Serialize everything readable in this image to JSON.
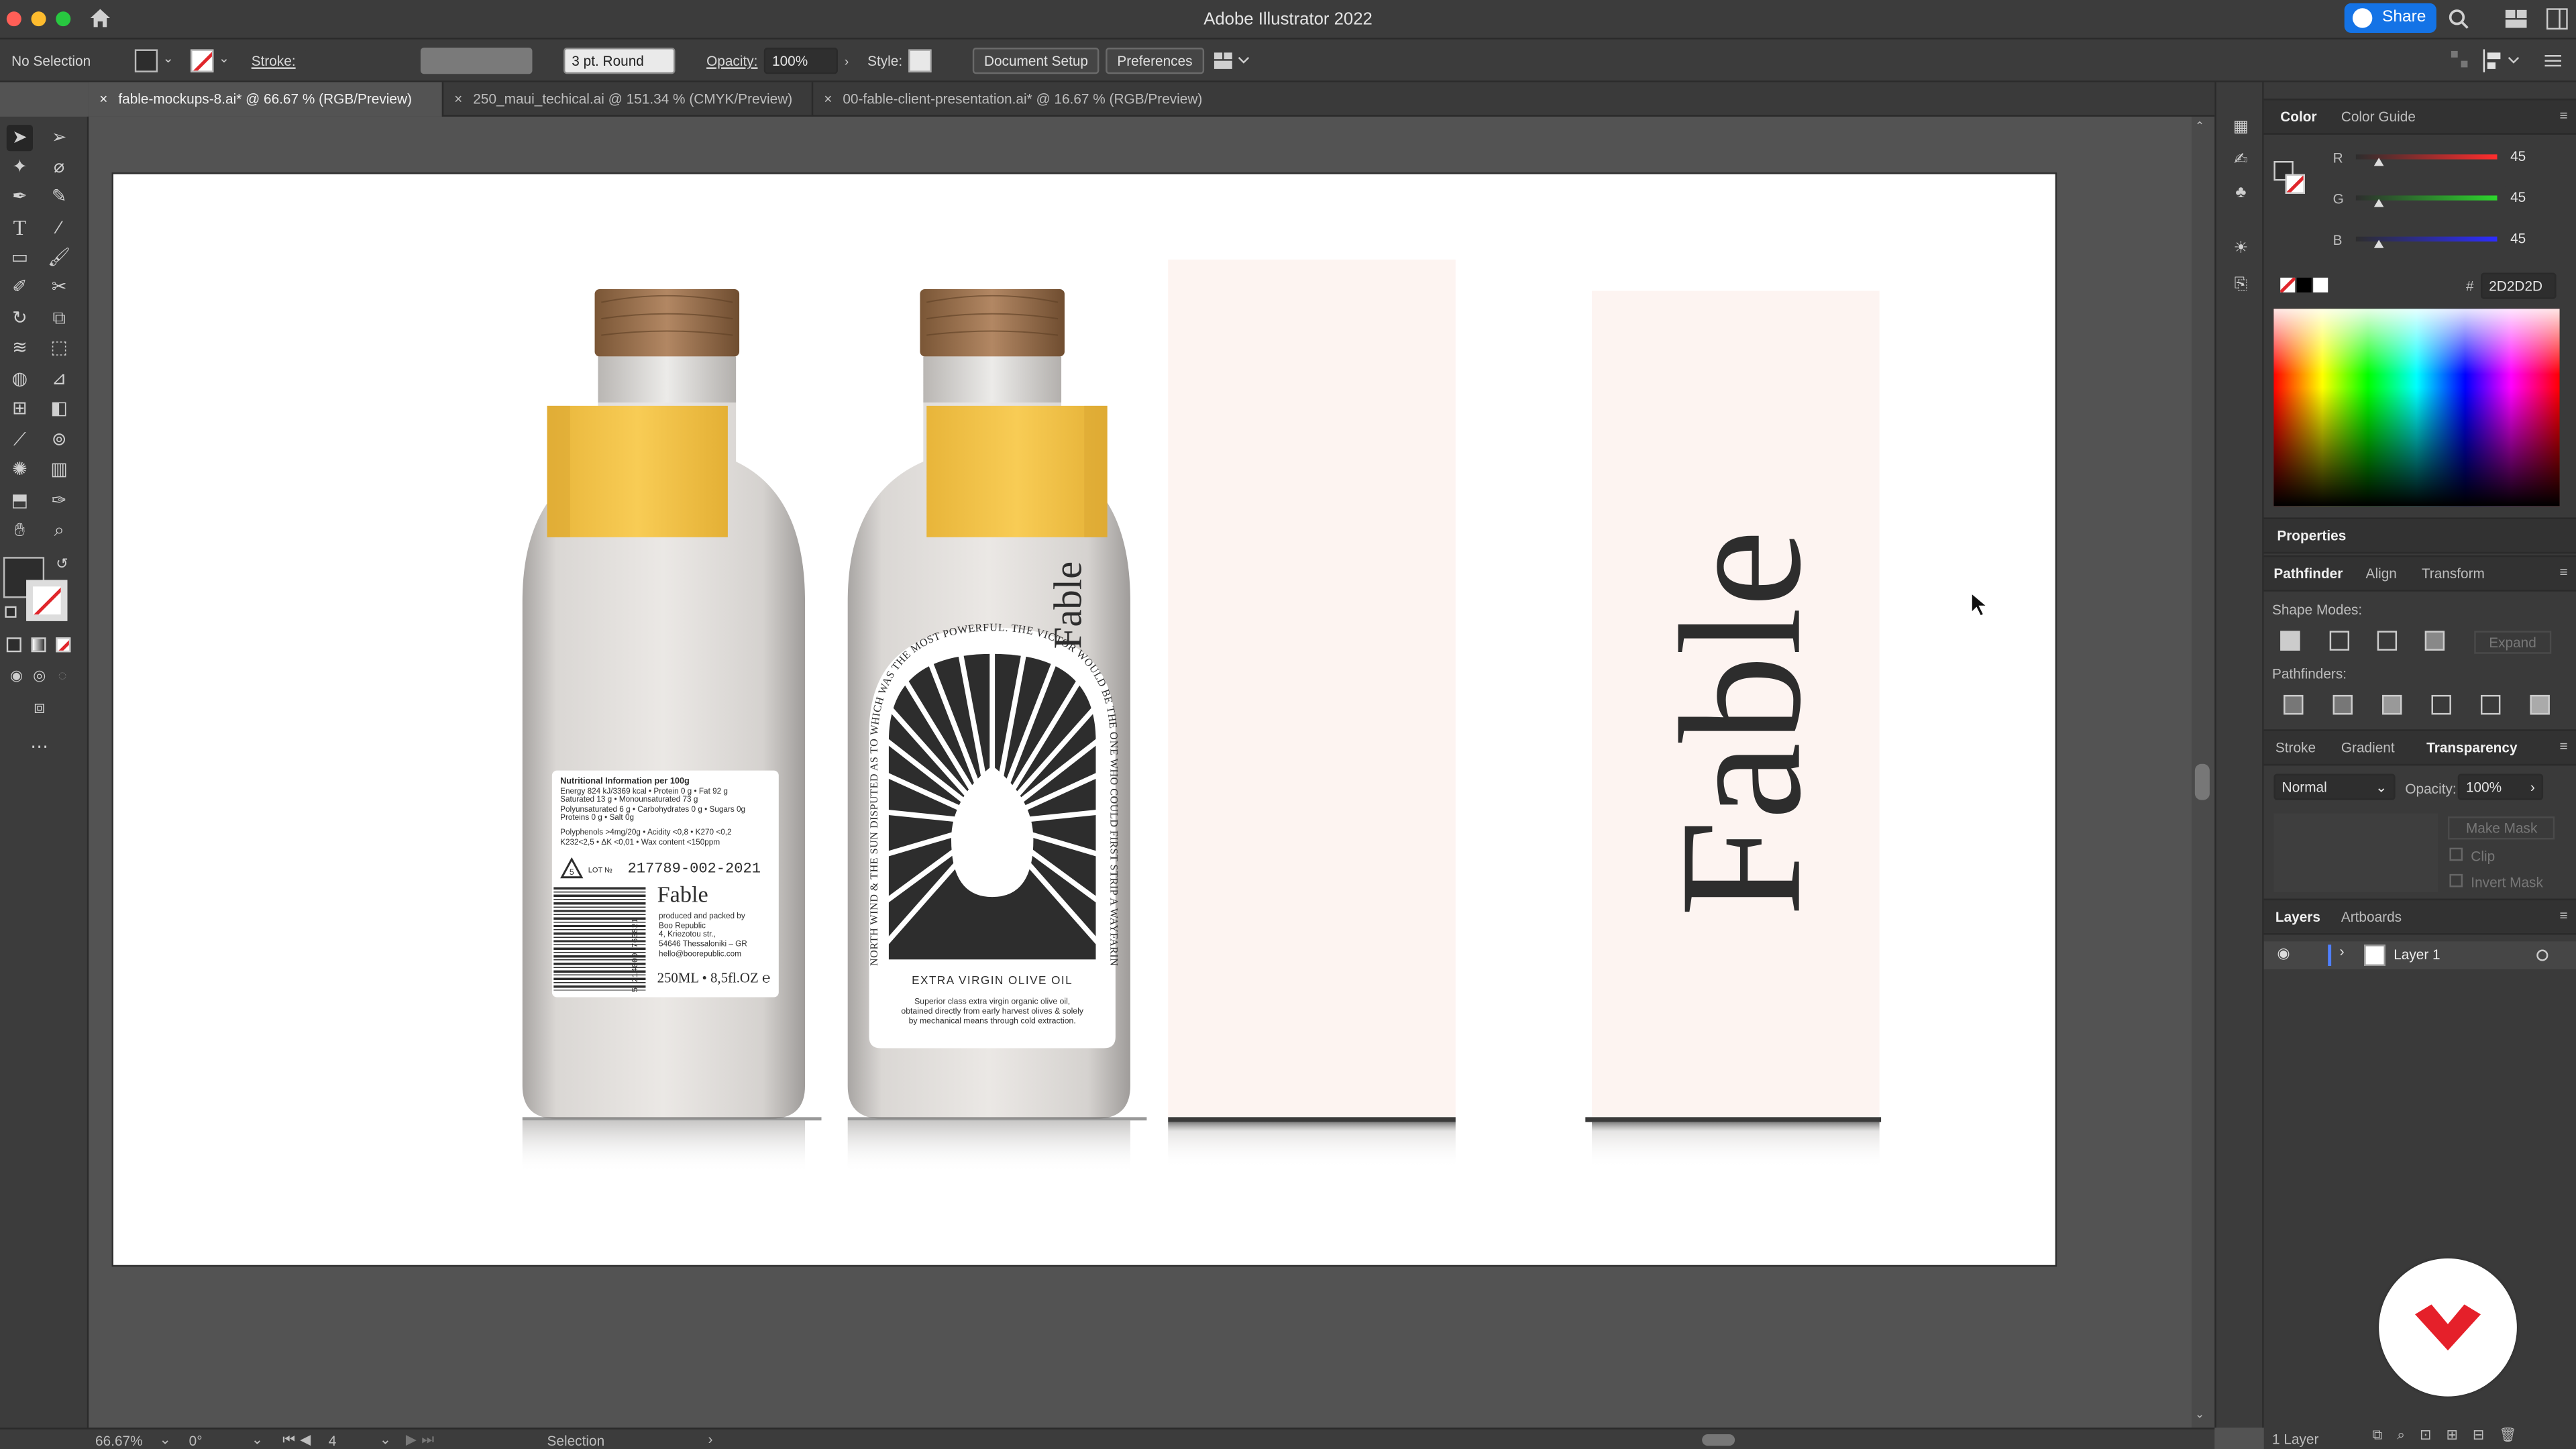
{
  "app": {
    "title": "Adobe Illustrator 2022",
    "share_label": "Share"
  },
  "control_bar": {
    "selection_state": "No Selection",
    "stroke_label": "Stroke:",
    "brush_value": "3 pt. Round",
    "opacity_label": "Opacity:",
    "opacity_value": "100%",
    "style_label": "Style:",
    "document_setup_label": "Document Setup",
    "preferences_label": "Preferences"
  },
  "tabs": [
    {
      "label": "fable-mockups-8.ai* @ 66.67 % (RGB/Preview)",
      "active": true
    },
    {
      "label": "250_maui_techical.ai @ 151.34 % (CMYK/Preview)",
      "active": false
    },
    {
      "label": "00-fable-client-presentation.ai* @ 16.67 % (RGB/Preview)",
      "active": false
    }
  ],
  "color_panel": {
    "tabs": [
      "Color",
      "Color Guide"
    ],
    "r_label": "R",
    "r_value": "45",
    "g_label": "G",
    "g_value": "45",
    "b_label": "B",
    "b_value": "45",
    "hash": "#",
    "hex_value": "2D2D2D",
    "color_hex": "#2D2D2D"
  },
  "properties_panel": {
    "title": "Properties"
  },
  "pathfinder_panel": {
    "tabs": [
      "Pathfinder",
      "Align",
      "Transform"
    ],
    "shape_modes_label": "Shape Modes:",
    "expand_label": "Expand",
    "pathfinders_label": "Pathfinders:"
  },
  "transparency_panel": {
    "tabs": [
      "Stroke",
      "Gradient",
      "Transparency"
    ],
    "blend_mode": "Normal",
    "opacity_label": "Opacity:",
    "opacity_value": "100%",
    "make_mask_label": "Make Mask",
    "clip_label": "Clip",
    "invert_mask_label": "Invert Mask"
  },
  "layers_panel": {
    "tabs": [
      "Layers",
      "Artboards"
    ],
    "layers": [
      {
        "name": "Layer 1"
      }
    ],
    "footer_count": "1 Layer"
  },
  "status_bar": {
    "zoom": "66.67%",
    "rotation": "0°",
    "artboard_number": "4",
    "tool_name": "Selection"
  },
  "artwork": {
    "brand_name": "Fable",
    "nutrition_title": "Nutritional Information per 100g",
    "nutrition_lines": [
      "Energy 824 kJ/3369 kcal • Protein 0 g • Fat 92 g",
      "Saturated 13 g • Monounsaturated 73 g",
      "Polyunsaturated 6 g • Carbohydrates 0 g • Sugars 0g",
      "Proteins 0 g • Salt 0g"
    ],
    "chem_lines": [
      "Polyphenols >4mg/20g • Acidity <0,8 • K270 <0,2",
      "K232<2,5 • ΔK <0,01 • Wax content <150ppm"
    ],
    "lot_label": "LOT №",
    "lot_number": "217789-002-2021",
    "barcode_digits": "5 214000 763821",
    "producer_lines": [
      "produced and packed by",
      "Boo Republic",
      "4, Kriezotou str.,",
      "54646 Thessaloniki – GR",
      "hello@boorepublic.com"
    ],
    "volume": "250ML • 8,5fl.OZ ℮",
    "ring_text": "NORTH WIND & THE SUN DISPUTED AS TO WHICH WAS THE MOST POWERFUL. THE VICTOR WOULD BE THE ONE WHO COULD FIRST STRIP A WAYFARING MAN OF HIS CLOAK",
    "product_title": "EXTRA VIRGIN OLIVE OIL",
    "product_desc_lines": [
      "Superior class extra virgin organic olive oil,",
      "obtained directly from early harvest olives & solely",
      "by mechanical means through cold extraction."
    ],
    "colors": {
      "cap_yellow": "#F6C646",
      "bottle": "#E3E0DD",
      "paper_pink": "#FDF4F1",
      "ink": "#2D2D2D",
      "cork": "#9B7050"
    }
  }
}
